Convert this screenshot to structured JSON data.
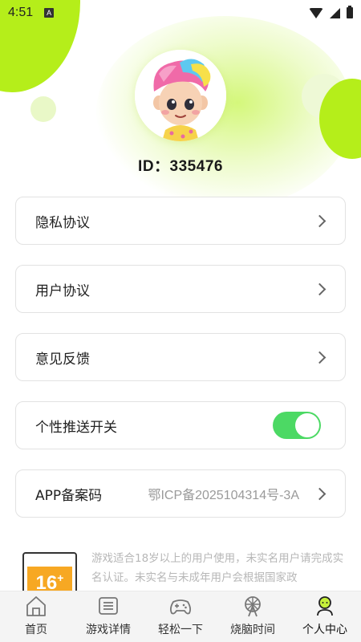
{
  "status_bar": {
    "time": "4:51",
    "notification_letter": "A"
  },
  "profile": {
    "id_label": "ID：335476"
  },
  "menu": {
    "privacy": "隐私协议",
    "user_agreement": "用户协议",
    "feedback": "意见反馈",
    "push_toggle": {
      "label": "个性推送开关",
      "on": true
    },
    "app_filing": {
      "label": "APP备案码",
      "value": "鄂ICP备2025104314号-3A"
    }
  },
  "age_rating": {
    "badge": "16",
    "badge_plus": "+",
    "notice": "游戏适合18岁以上的用户使用，未实名用户请完成实名认证。未实名与未成年用户会根据国家政"
  },
  "tabs": [
    {
      "label": "首页",
      "icon": "home-icon"
    },
    {
      "label": "游戏详情",
      "icon": "game-details-icon"
    },
    {
      "label": "轻松一下",
      "icon": "gamepad-icon"
    },
    {
      "label": "烧脑时间",
      "icon": "ferris-wheel-icon"
    },
    {
      "label": "个人中心",
      "icon": "profile-icon"
    }
  ],
  "colors": {
    "accent": "#b5ee1a",
    "toggle_on": "#4cd964",
    "badge": "#f7a823"
  }
}
